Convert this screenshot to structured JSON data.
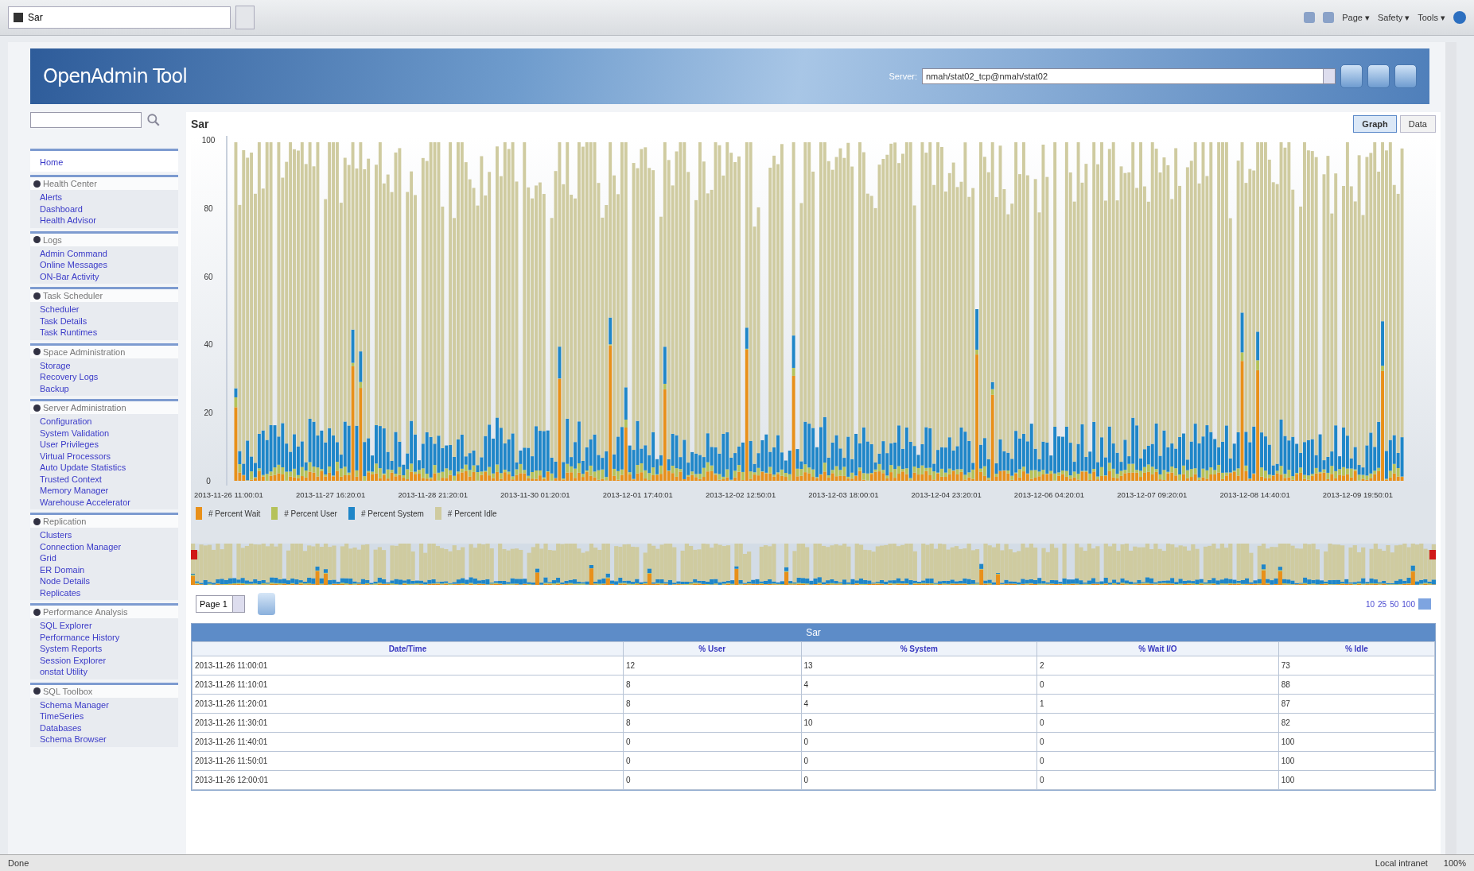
{
  "browser": {
    "tab_title": "Sar",
    "toolbar": [
      "Page ▾",
      "Safety ▾",
      "Tools ▾"
    ]
  },
  "header": {
    "title": "OpenAdmin Tool",
    "server_label": "Server:",
    "server_value": "nmah/stat02_tcp@nmah/stat02"
  },
  "sidebar": {
    "home": "Home",
    "groups": [
      {
        "title": "Health Center",
        "items": [
          "Alerts",
          "Dashboard",
          "Health Advisor"
        ]
      },
      {
        "title": "Logs",
        "items": [
          "Admin Command",
          "Online Messages",
          "ON-Bar Activity"
        ]
      },
      {
        "title": "Task Scheduler",
        "items": [
          "Scheduler",
          "Task Details",
          "Task Runtimes"
        ]
      },
      {
        "title": "Space Administration",
        "items": [
          "Storage",
          "Recovery Logs",
          "Backup"
        ]
      },
      {
        "title": "Server Administration",
        "items": [
          "Configuration",
          "System Validation",
          "User Privileges",
          "Virtual Processors",
          "Auto Update Statistics",
          "Trusted Context",
          "Memory Manager",
          "Warehouse Accelerator"
        ]
      },
      {
        "title": "Replication",
        "items": [
          "Clusters",
          "Connection Manager",
          "Grid",
          "ER Domain",
          "Node Details",
          "Replicates"
        ]
      },
      {
        "title": "Performance Analysis",
        "items": [
          "SQL Explorer",
          "Performance History",
          "System Reports",
          "Session Explorer",
          "onstat Utility"
        ]
      },
      {
        "title": "SQL Toolbox",
        "items": [
          "Schema Manager",
          "TimeSeries",
          "Databases",
          "Schema Browser"
        ]
      }
    ]
  },
  "page": {
    "title": "Sar",
    "view_tabs": [
      {
        "label": "Graph",
        "selected": true
      },
      {
        "label": "Data",
        "selected": false
      }
    ]
  },
  "chart": {
    "y_labels": [
      "100",
      "80",
      "60",
      "40",
      "20",
      "0"
    ],
    "x_labels": [
      "2013-11-26 11:00:01",
      "2013-11-27 16:20:01",
      "2013-11-28 21:20:01",
      "2013-11-30 01:20:01",
      "2013-12-01 17:40:01",
      "2013-12-02 12:50:01",
      "2013-12-03 18:00:01",
      "2013-12-04 23:20:01",
      "2013-12-06 04:20:01",
      "2013-12-07 09:20:01",
      "2013-12-08 14:40:01",
      "2013-12-09 19:50:01"
    ],
    "legend": [
      {
        "label": "# Percent Wait",
        "color": "#e8901a"
      },
      {
        "label": "# Percent User",
        "color": "#b5c25a"
      },
      {
        "label": "# Percent System",
        "color": "#1f86c8"
      },
      {
        "label": "# Percent Idle",
        "color": "#cfcba0"
      }
    ]
  },
  "pager": {
    "page_select": "Page 1",
    "page_sizes": [
      "10",
      "25",
      "50",
      "100"
    ]
  },
  "table": {
    "title": "Sar",
    "columns": [
      "Date/Time",
      "% User",
      "% System",
      "% Wait I/O",
      "% Idle"
    ],
    "rows": [
      [
        "2013-11-26 11:00:01",
        "12",
        "13",
        "2",
        "73"
      ],
      [
        "2013-11-26 11:10:01",
        "8",
        "4",
        "0",
        "88"
      ],
      [
        "2013-11-26 11:20:01",
        "8",
        "4",
        "1",
        "87"
      ],
      [
        "2013-11-26 11:30:01",
        "8",
        "10",
        "0",
        "82"
      ],
      [
        "2013-11-26 11:40:01",
        "0",
        "0",
        "0",
        "100"
      ],
      [
        "2013-11-26 11:50:01",
        "0",
        "0",
        "0",
        "100"
      ],
      [
        "2013-11-26 12:00:01",
        "0",
        "0",
        "0",
        "100"
      ]
    ]
  },
  "status_bar": {
    "left": "Done",
    "zone": "Local intranet",
    "zoom": "100%"
  }
}
